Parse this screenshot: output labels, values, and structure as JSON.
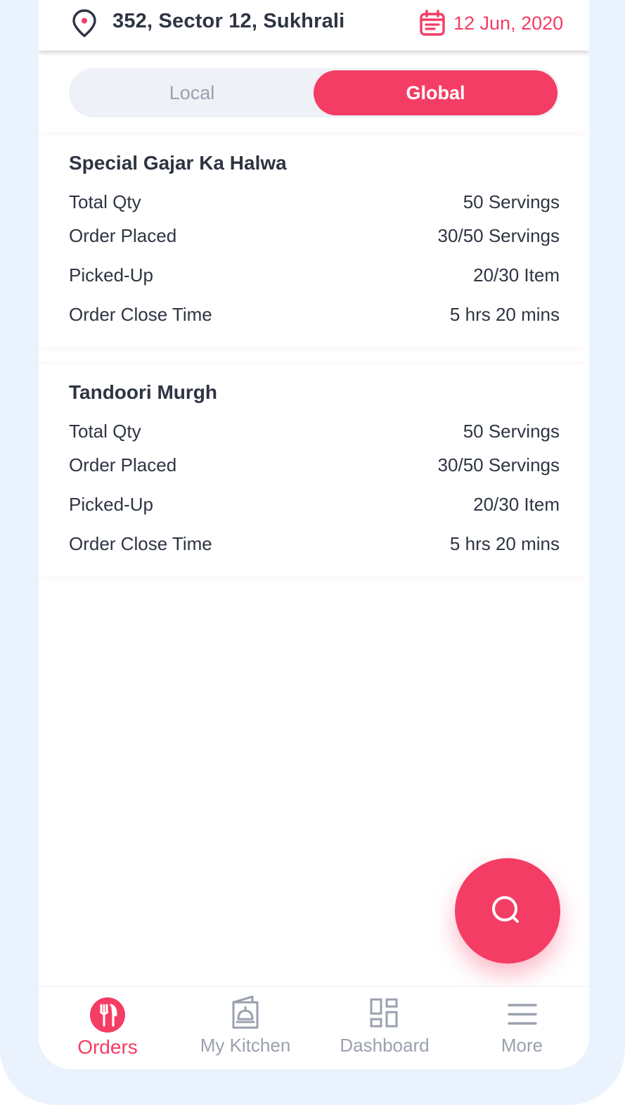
{
  "header": {
    "address": "352, Sector 12, Sukhrali",
    "date": "12 Jun, 2020",
    "location_icon": "location-pin-icon",
    "calendar_icon": "calendar-icon"
  },
  "toggle": {
    "local_label": "Local",
    "global_label": "Global",
    "selected": "Global"
  },
  "orders": [
    {
      "title": "Special Gajar Ka Halwa",
      "rows": [
        {
          "label": "Total Qty",
          "value": "50 Servings"
        },
        {
          "label": "Order Placed",
          "value": "30/50 Servings"
        },
        {
          "label": "Picked-Up",
          "value": "20/30 Item"
        },
        {
          "label": "Order Close Time",
          "value": "5 hrs 20 mins"
        }
      ]
    },
    {
      "title": "Tandoori Murgh",
      "rows": [
        {
          "label": "Total Qty",
          "value": "50 Servings"
        },
        {
          "label": "Order Placed",
          "value": "30/50 Servings"
        },
        {
          "label": "Picked-Up",
          "value": "20/30 Item"
        },
        {
          "label": "Order Close Time",
          "value": "5 hrs 20 mins"
        }
      ]
    }
  ],
  "fab": {
    "icon": "search-icon"
  },
  "bottom_nav": [
    {
      "label": "Orders",
      "icon": "fork-knife-icon",
      "active": true
    },
    {
      "label": "My Kitchen",
      "icon": "kitchen-cloche-icon",
      "active": false
    },
    {
      "label": "Dashboard",
      "icon": "dashboard-grid-icon",
      "active": false
    },
    {
      "label": "More",
      "icon": "menu-lines-icon",
      "active": false
    }
  ],
  "colors": {
    "accent": "#f43d64",
    "text": "#2e3442",
    "muted": "#9aa0ae",
    "frame": "#eaf3fd"
  }
}
